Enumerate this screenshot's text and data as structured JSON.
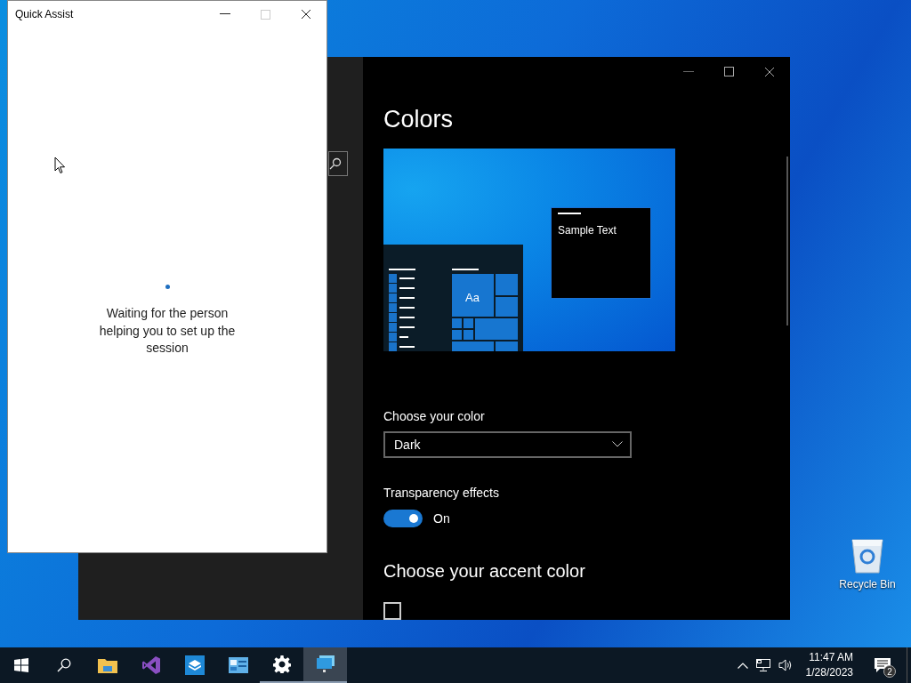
{
  "quick_assist": {
    "title": "Quick Assist",
    "status": "Waiting for the person helping you to set up the session"
  },
  "settings": {
    "page_title": "Colors",
    "preview": {
      "sample_text": "Sample Text",
      "tile_label": "Aa"
    },
    "color_label": "Choose your color",
    "color_dropdown": {
      "value": "Dark"
    },
    "transparency": {
      "label": "Transparency effects",
      "on": true,
      "state_text": "On"
    },
    "accent_heading": "Choose your accent color",
    "auto_accent": {
      "checked": false
    }
  },
  "desktop_icons": [
    {
      "label": "Recycle Bin"
    }
  ],
  "taskbar": {
    "apps": [
      {
        "kind": "explorer",
        "running": false,
        "active": false
      },
      {
        "kind": "studio",
        "running": false,
        "active": false
      },
      {
        "kind": "sandbox",
        "running": false,
        "active": false
      },
      {
        "kind": "panel",
        "running": false,
        "active": false
      },
      {
        "kind": "settings",
        "running": true,
        "active": false
      },
      {
        "kind": "remote",
        "running": true,
        "active": true
      }
    ],
    "time": "11:47 AM",
    "date": "1/28/2023",
    "notification_count": "2"
  }
}
